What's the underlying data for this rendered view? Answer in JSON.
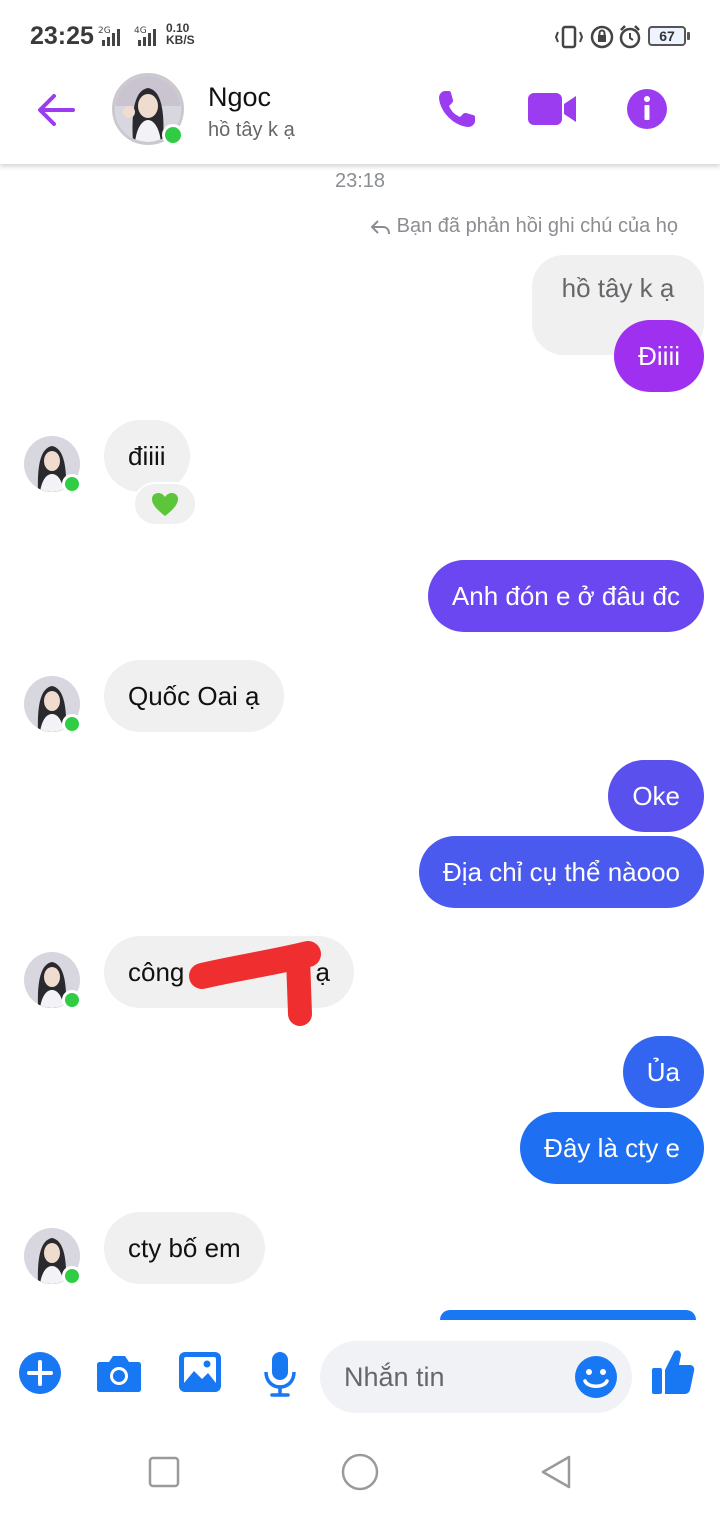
{
  "status_bar": {
    "time": "23:25",
    "net1": "2G",
    "net2": "4G",
    "speed_value": "0.10",
    "speed_unit": "KB/S",
    "battery": "67"
  },
  "header": {
    "name": "Ngoc",
    "subtitle": "hồ tây k ạ"
  },
  "chat": {
    "timestamp": "23:18",
    "reply_note": "Bạn đã phản hồi ghi chú của họ",
    "messages": [
      {
        "from": "me",
        "text": "hồ tây k ạ",
        "quoted": true
      },
      {
        "from": "me",
        "text": "Điiii"
      },
      {
        "from": "them",
        "text": "điiii",
        "reaction": "green-heart"
      },
      {
        "from": "me",
        "text": "Anh đón e ở đâu đc"
      },
      {
        "from": "them",
        "text": "Quốc Oai ạ"
      },
      {
        "from": "me",
        "text": "Oke"
      },
      {
        "from": "me",
        "text": "Địa chỉ cụ thể nàooo"
      },
      {
        "from": "them",
        "text_start": "công",
        "text_end": "ạ",
        "redacted": true
      },
      {
        "from": "me",
        "text": "Ủa"
      },
      {
        "from": "me",
        "text": "Đây là cty e"
      },
      {
        "from": "them",
        "text": "cty bố em"
      }
    ]
  },
  "composer": {
    "placeholder": "Nhắn tin"
  },
  "colors": {
    "accent_purple": "#9b3cf0",
    "bubble_violet": "#a030f0",
    "bubble_indigo": "#6a47f0",
    "bubble_blue_purple": "#5a50ee",
    "bubble_royal": "#3f63f0",
    "bubble_blue": "#1f6ff2",
    "composer_blue": "#1877f2",
    "incoming_bubble": "#f0f0f0",
    "online_green": "#31cc46",
    "redaction_red": "#ef2f2f"
  }
}
